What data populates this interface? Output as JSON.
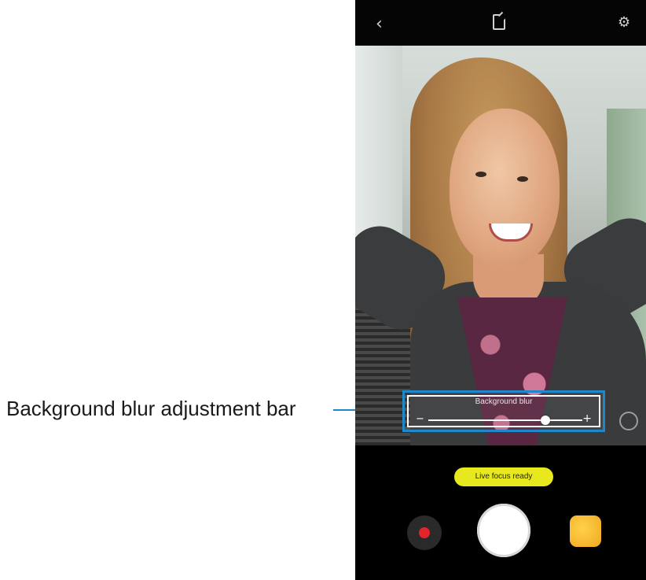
{
  "callout": {
    "label": "Background blur adjustment bar"
  },
  "topbar": {
    "back_icon": "‹",
    "mode_icon": "live-focus-mode-icon",
    "settings_icon": "⚙"
  },
  "viewfinder": {
    "blur_control": {
      "label": "Background blur",
      "minus": "−",
      "plus": "+",
      "level": 0.76
    }
  },
  "bottom": {
    "status_badge": "Live focus ready"
  },
  "colors": {
    "callout_line": "#1e88c8",
    "badge": "#e8e81e",
    "record_dot": "#e3242b"
  }
}
